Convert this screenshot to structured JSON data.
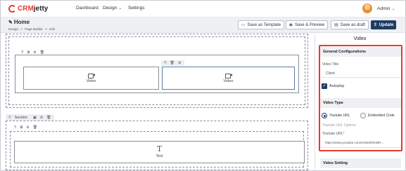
{
  "nav": {
    "logo_crm": "CRM",
    "logo_jetty": "jetty",
    "dashboard": "Dashboard",
    "design": "Design",
    "settings": "Settings",
    "user": "Admin"
  },
  "header": {
    "title": "Home",
    "breadcrumb": [
      "Design",
      ">",
      "Page Builder",
      ">",
      "Edit"
    ],
    "btn_template": "Save as Template",
    "btn_preview": "Save & Preview",
    "btn_draft": "Save as draft",
    "btn_update": "Update"
  },
  "canvas": {
    "video1": "Video",
    "video2": "Video",
    "section_label": "Section",
    "text_element": "Text"
  },
  "panel": {
    "title": "Video",
    "general_header": "General Configurations",
    "video_title_label": "Video Title",
    "video_title_value": "Client",
    "autoplay_label": "Autoplay",
    "autoplay_checked": true,
    "video_type_header": "Video Type",
    "radio_youtube": "Youtube URL",
    "radio_embedded": "Embedded Code",
    "youtube_options_label": "Youtube URL Options",
    "youtube_url_label": "Youtube URL*",
    "youtube_url_value": "https://www.youtube.com/embed/9mMR...",
    "video_setting_header": "Video Setting"
  },
  "colors": {
    "accent": "#1f3d63",
    "highlight": "#e53935",
    "header_bg": "#eef0f4"
  }
}
